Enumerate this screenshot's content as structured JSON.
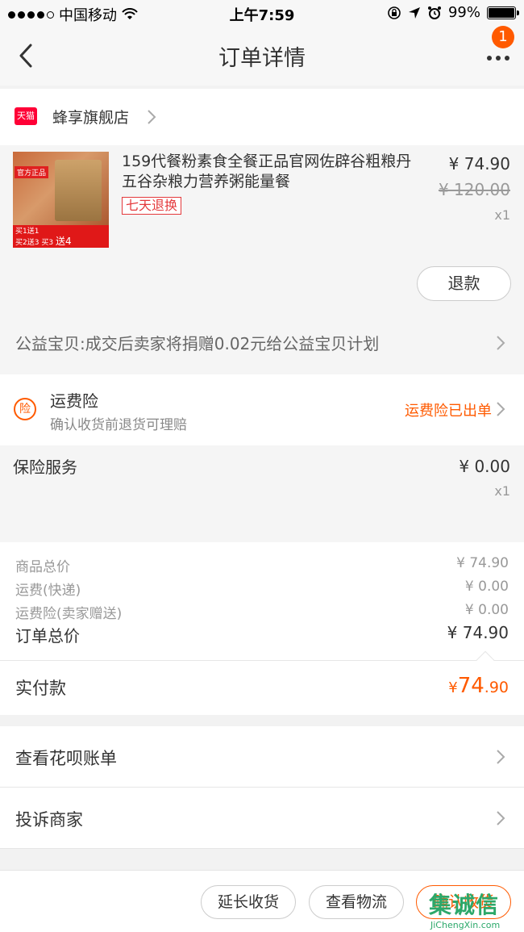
{
  "status_bar": {
    "carrier": "中国移动",
    "time": "上午7:59",
    "battery": "99%"
  },
  "nav": {
    "title": "订单详情",
    "badge_count": "1"
  },
  "shop": {
    "name": "蜂享旗舰店",
    "platform_badge": "天猫"
  },
  "product": {
    "name": "159代餐粉素食全餐正品官网佐辟谷粗粮丹五谷杂粮力营养粥能量餐",
    "tag": "七天退换",
    "price": "¥ 74.90",
    "original_price": "¥ 120.00",
    "quantity": "x1",
    "thumb_label": "官方正品",
    "thumb_promo_line1": "买1送1",
    "thumb_promo_line2": "买2送3",
    "thumb_promo_3": "买3",
    "thumb_promo_4": "送4",
    "refund_button": "退款"
  },
  "charity": {
    "text": "公益宝贝:成交后卖家将捐赠0.02元给公益宝贝计划"
  },
  "shipping_insurance": {
    "icon": "险",
    "title": "运费险",
    "subtitle": "确认收货前退货可理赔",
    "status": "运费险已出单"
  },
  "insurance_service": {
    "label": "保险服务",
    "price": "¥ 0.00",
    "quantity": "x1"
  },
  "totals": {
    "goods_label": "商品总价",
    "goods_value": "¥ 74.90",
    "shipping_label": "运费(快递)",
    "shipping_value": "¥ 0.00",
    "ins_label": "运费险(卖家赠送)",
    "ins_value": "¥ 0.00",
    "order_label": "订单总价",
    "order_value": "¥ 74.90"
  },
  "paid": {
    "label": "实付款",
    "currency": "¥",
    "int": "74",
    "dec": ".90"
  },
  "links": [
    {
      "label": "查看花呗账单"
    },
    {
      "label": "投诉商家"
    }
  ],
  "actions": {
    "extend": "延长收货",
    "logistics": "查看物流",
    "confirm": "确认收货"
  },
  "watermark": {
    "text": "集诚信",
    "url": "JiChengXin.com"
  },
  "colors": {
    "accent": "#ff5a00",
    "tmall_red": "#ff0036",
    "tag_red": "#e4393c"
  }
}
